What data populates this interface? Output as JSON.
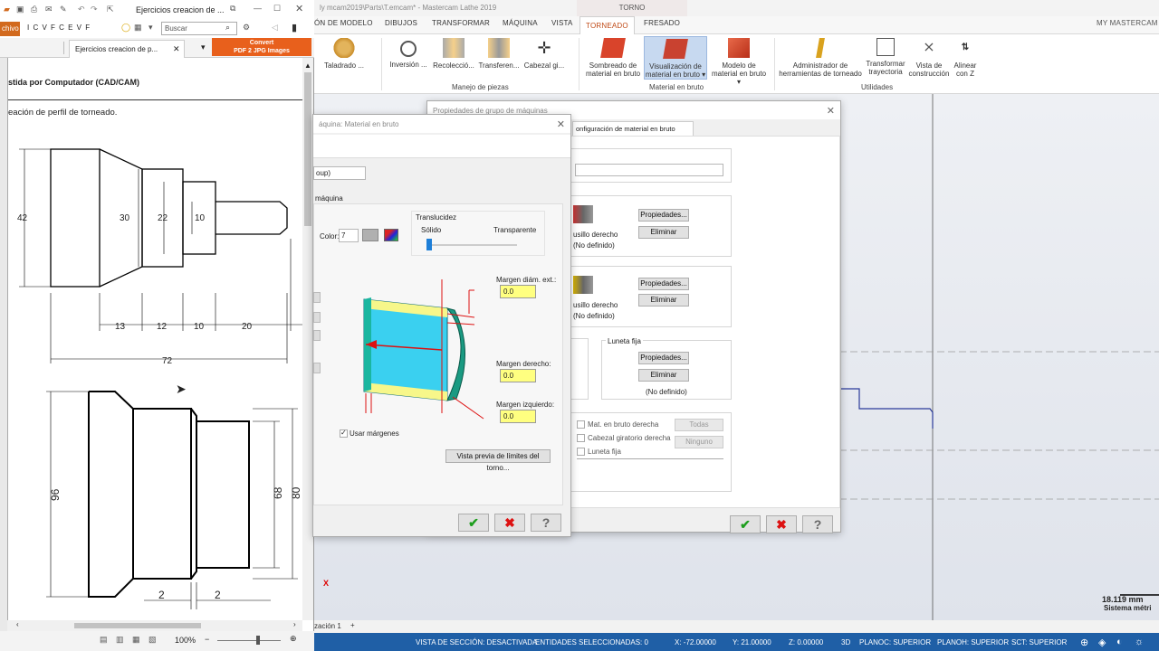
{
  "pdf": {
    "tab_title": "Ejercicios creacion de ...",
    "search_placeholder": "Buscar",
    "file_tab": "chivo",
    "toolbar_letters": "I C V F C E V F",
    "doc_tab": "Ejercicios creacion de p...",
    "convert_line1": "Convert",
    "convert_line2": "PDF 2 JPG Images",
    "heading": "stida por Computador (CAD/CAM)",
    "subheading": "eación de perfil de torneado.",
    "zoom": "100%",
    "dims1": {
      "d42": "42",
      "d30": "30",
      "d22": "22",
      "d10": "10",
      "d13": "13",
      "d12": "12",
      "d10b": "10",
      "d20": "20",
      "d72": "72"
    },
    "dims2": {
      "d96": "96",
      "d68": "68",
      "d80": "80",
      "d2a": "2",
      "d2b": "2"
    }
  },
  "mc": {
    "title": "ly mcam2019\\Parts\\T.emcam* - Mastercam Lathe 2019",
    "context_tab": "TORNO",
    "tabs": [
      "ÓN DE MODELO",
      "DIBUJOS",
      "TRANSFORMAR",
      "MÁQUINA",
      "VISTA",
      "TORNEADO",
      "FRESADO"
    ],
    "active_tab": "TORNEADO",
    "my_mastercam": "MY MASTERCAM",
    "ribbon": {
      "taladrado": "Taladrado ...",
      "inversion": "Inversión ...",
      "recoleccion": "Recolecció...",
      "transferencia": "Transferen...",
      "cabezal": "Cabezal gi...",
      "group1": "Manejo de piezas",
      "sombreado": [
        "Sombreado de",
        "material en bruto"
      ],
      "visualizacion": [
        "Visualización de",
        "material en bruto ▾"
      ],
      "modelo": [
        "Modelo de",
        "material en bruto ▾"
      ],
      "group2": "Material en bruto",
      "admin": [
        "Administrador de",
        "herramientas de torneado"
      ],
      "transformar": [
        "Transformar",
        "trayectoria"
      ],
      "vista": [
        "Vista de",
        "construcción"
      ],
      "alinear": [
        "Alinear",
        "con Z"
      ],
      "group3": "Utilidades"
    },
    "status": {
      "section_view": "VISTA DE SECCIÓN: DESACTIVADA",
      "selected": "ENTIDADES SELECCIONADAS: 0",
      "x": "X:   -72.00000",
      "y": "Y:   21.00000",
      "z": "Z:   0.00000",
      "mode": "3D",
      "planoc": "PLANOC: SUPERIOR",
      "planoh": "PLANOH: SUPERIOR",
      "sct": "SCT: SUPERIOR"
    },
    "viewport_tab": "zación 1",
    "scale": "18.119 mm",
    "scale_sub": "Sistema métri",
    "axis_x": "X"
  },
  "props_dialog": {
    "title": "Propiedades de grupo de máquinas",
    "tab": "onfiguración de material en bruto",
    "spindle_right": "usillo derecho",
    "undefined1": "(No definido)",
    "spindle_right2": "usillo derecho",
    "undefined2": "(No definido)",
    "steady_rest": "Luneta fija",
    "undefined3": "(No definido)",
    "properties_btn": "Propiedades...",
    "delete_btn": "Eliminar",
    "chk1": "Mat. en bruto derecha",
    "chk2": "Cabezal giratorio derecha",
    "chk3": "Luneta fija",
    "all_btn": "Todas",
    "none_btn": "Ninguno"
  },
  "stock_dialog": {
    "title": "áquina: Material en bruto",
    "name_value": "oup)",
    "section": "máquina",
    "color_label": "Color:",
    "color_value": "7",
    "translucency": "Translucidez",
    "solid": "Sólido",
    "transparent": "Transparente",
    "margin_ext": "Margen diám. ext.:",
    "margin_ext_val": "0.0",
    "margin_right": "Margen derecho:",
    "margin_right_val": "0.0",
    "margin_left": "Margen izquierdo:",
    "margin_left_val": "0.0",
    "use_margins": "Usar márgenes",
    "preview_btn": "Vista previa de límites del torno..."
  }
}
